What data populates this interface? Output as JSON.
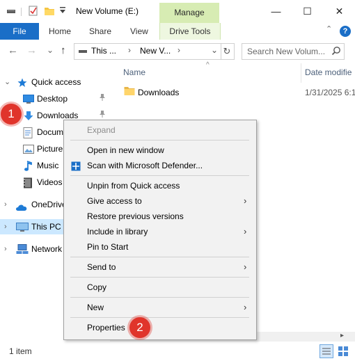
{
  "window": {
    "title": "New Volume (E:)",
    "manage_tab": "Manage",
    "minimize": "—",
    "maximize": "☐",
    "close": "✕"
  },
  "ribbon": {
    "file_tab": "File",
    "tabs": [
      "Home",
      "Share",
      "View"
    ],
    "drive_tools_tab": "Drive Tools",
    "help": "?",
    "collapse": "⌃"
  },
  "address": {
    "back": "←",
    "forward": "→",
    "recent": "⌄",
    "up": "↑",
    "crumb1": "This ...",
    "sep": "›",
    "crumb2": "New V...",
    "dropdown": "⌄",
    "refresh": "↻",
    "search_placeholder": "Search New Volum..."
  },
  "nav": {
    "quick_access": "Quick access",
    "items": [
      {
        "label": "Desktop",
        "icon": "desktop-icon"
      },
      {
        "label": "Downloads",
        "icon": "download-arrow-icon"
      },
      {
        "label": "Docum",
        "icon": "documents-icon"
      },
      {
        "label": "Picture",
        "icon": "pictures-icon"
      },
      {
        "label": "Music",
        "icon": "music-icon"
      },
      {
        "label": "Videos",
        "icon": "videos-icon"
      }
    ],
    "onedrive": "OneDrive",
    "this_pc": "This PC",
    "network": "Network"
  },
  "content": {
    "col_name": "Name",
    "col_date": "Date modifie",
    "sort_arrow": "^",
    "rows": [
      {
        "name": "Downloads",
        "date": "1/31/2025 6:1"
      }
    ]
  },
  "status": {
    "item_count": "1 item"
  },
  "context_menu": {
    "expand": "Expand",
    "open_new_window": "Open in new window",
    "scan_defender": "Scan with Microsoft Defender...",
    "unpin": "Unpin from Quick access",
    "give_access": "Give access to",
    "restore_versions": "Restore previous versions",
    "include_library": "Include in library",
    "pin_start": "Pin to Start",
    "send_to": "Send to",
    "copy": "Copy",
    "new": "New",
    "properties": "Properties",
    "submenu_arrow": "›"
  },
  "badges": {
    "step1": "1",
    "step2": "2"
  },
  "colors": {
    "accent": "#1a6ec7",
    "manage_green": "#d7ecb3",
    "badge_red": "#e0342b",
    "selection": "#cce8ff"
  }
}
